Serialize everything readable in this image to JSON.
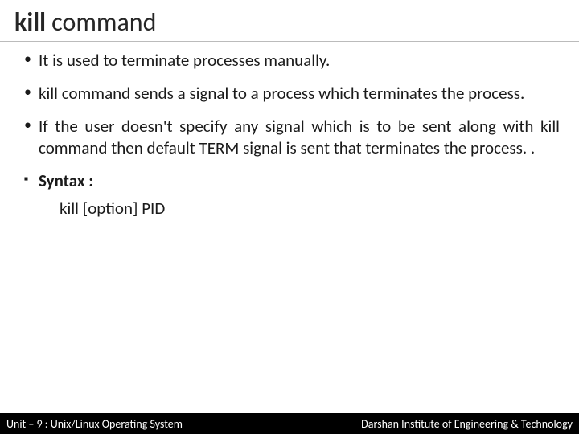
{
  "title": {
    "bold": "kill",
    "rest": " command"
  },
  "bullets": {
    "b1": "It is used to terminate processes manually.",
    "b2": "kill command sends a signal to a process which terminates the process.",
    "b3": "If the user doesn't specify any signal which is to be sent along with kill command then default TERM signal is sent that terminates the process. .",
    "b4": "Syntax :",
    "syntax": "kill [option] PID"
  },
  "footer": {
    "left": "Unit – 9  : Unix/Linux Operating System",
    "right": "Darshan Institute of Engineering & Technology"
  }
}
